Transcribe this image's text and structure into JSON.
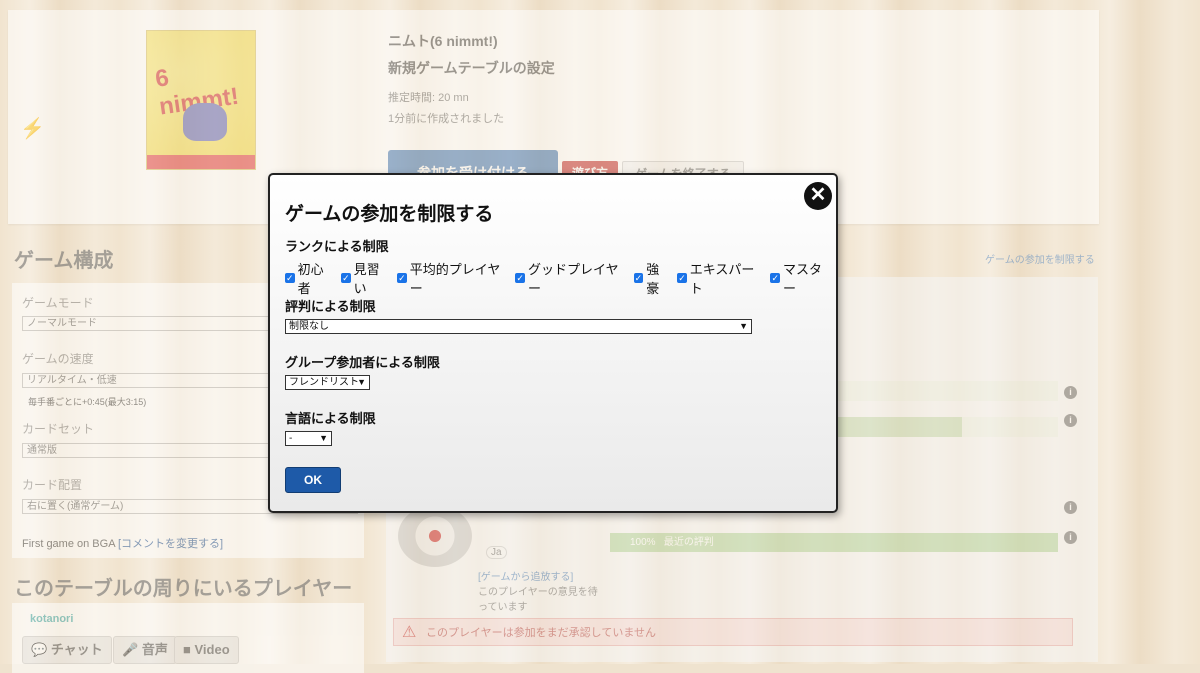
{
  "header": {
    "game_title": "ニムト(6 nimmt!)",
    "subtitle": "新規ゲームテーブルの設定",
    "estimated_time": "推定時間: 20 mn",
    "created": "1分前に作成されました",
    "accept_button": "参加を受け付ける",
    "howto_button": "遊び方",
    "end_button": "ゲームを終了する",
    "boxart_text": "6 nimmt!"
  },
  "config": {
    "section_title": "ゲーム構成",
    "restrict_link": "ゲームの参加を制限する",
    "fields": [
      {
        "label": "ゲームモード",
        "value": "ノーマルモード"
      },
      {
        "label": "ゲームの速度",
        "value": "リアルタイム・低速",
        "note": "毎手番ごとに+0:45(最大3:15)"
      },
      {
        "label": "カードセット",
        "value": "通常版"
      },
      {
        "label": "カード配置",
        "value": "右に置く(通常ゲーム)"
      }
    ],
    "first_game": "First game on BGA",
    "change_comment": "[コメントを変更する]"
  },
  "players": {
    "section_title": "このテーブルの周りにいるプレイヤー",
    "name": "kotanori",
    "chat": "チャット",
    "voice": "音声",
    "video": "Video"
  },
  "right": {
    "lang_badge": "Ja",
    "remove_link": "[ゲームから追放する]",
    "waiting_text": "このプレイヤーの意見を待っています",
    "percent": "100%",
    "reputation": "最近の評判",
    "warning": "このプレイヤーは参加をまだ承認していません"
  },
  "modal": {
    "title": "ゲームの参加を制限する",
    "rank_label": "ランクによる制限",
    "ranks": [
      "初心者",
      "見習い",
      "平均的プレイヤー",
      "グッドプレイヤー",
      "強豪",
      "エキスパート",
      "マスター"
    ],
    "reputation_label": "評判による制限",
    "reputation_value": "制限なし",
    "group_label": "グループ参加者による制限",
    "group_value": "フレンドリスト",
    "language_label": "言語による制限",
    "language_value": "-",
    "ok": "OK"
  }
}
